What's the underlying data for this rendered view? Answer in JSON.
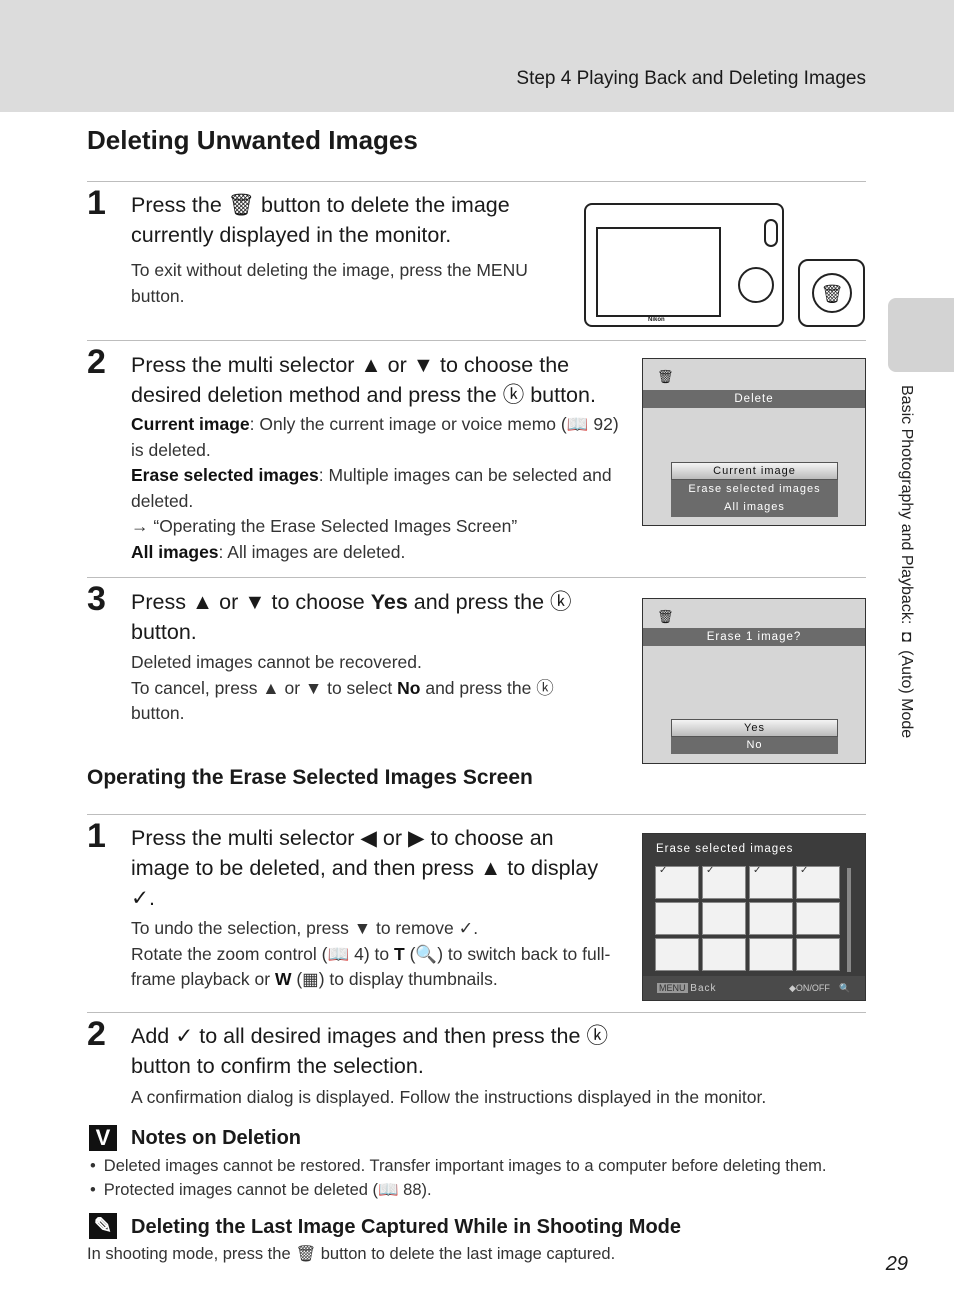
{
  "header": {
    "running_head": "Step 4 Playing Back and Deleting Images",
    "page_number": "29"
  },
  "side_tab": {
    "label": "Basic Photography and Playback: ◘ (Auto) Mode"
  },
  "title": "Deleting Unwanted Images",
  "steps_main": [
    {
      "number": "1",
      "heading": "Press the 🗑 button to delete the image currently displayed in the monitor.",
      "body": [
        "To exit without deleting the image, press the MENU button."
      ]
    },
    {
      "number": "2",
      "heading": "Press the multi selector ▲ or ▼ to choose the desired deletion method and press the ⓚ button.",
      "items": [
        {
          "term": "Current image",
          "desc": ": Only the current image or voice memo (📖 92) is deleted."
        },
        {
          "term": "Erase selected images",
          "desc": ": Multiple images can be selected and deleted."
        },
        {
          "term": "",
          "desc": "→ “Operating the Erase Selected Images Screen”"
        },
        {
          "term": "All images",
          "desc": ": All images are deleted."
        }
      ]
    },
    {
      "number": "3",
      "heading_pre": "Press ▲ or ▼ to choose ",
      "heading_bold": "Yes",
      "heading_post": " and press the ⓚ button.",
      "body1": "Deleted images cannot be recovered.",
      "body2_pre": "To cancel, press ▲ or ▼ to select ",
      "body2_bold": "No",
      "body2_post": " and press the ⓚ button."
    }
  ],
  "subsection": {
    "title": "Operating the Erase Selected Images Screen",
    "steps": [
      {
        "number": "1",
        "heading": "Press the multi selector ◀ or ▶ to choose an image to be deleted, and then press ▲ to display ✓.",
        "body1": "To undo the selection, press ▼ to remove ✓.",
        "body2_pre": "Rotate the zoom control (📖 4) to ",
        "body2_t": "T",
        "body2_mid": " (🔍) to switch back to full-frame playback or ",
        "body2_w": "W",
        "body2_post": " (▦) to display thumbnails."
      },
      {
        "number": "2",
        "heading": "Add ✓ to all desired images and then press the ⓚ button to confirm the selection.",
        "body": "A confirmation dialog is displayed. Follow the instructions displayed in the monitor."
      }
    ]
  },
  "notes": {
    "icon": "V",
    "title": "Notes on Deletion",
    "bullets": [
      "Deleted images cannot be restored. Transfer important images to a computer before deleting them.",
      "Protected images cannot be deleted (📖 88)."
    ]
  },
  "tip": {
    "icon": "✎",
    "title": "Deleting the Last Image Captured While in Shooting Mode",
    "body": "In shooting mode, press the 🗑 button to delete the last image captured."
  },
  "screens": {
    "delete_menu": {
      "trash": "🗑",
      "title": "Delete",
      "options": [
        "Current image",
        "Erase selected images",
        "All images"
      ],
      "selected_index": 0
    },
    "confirm": {
      "trash": "🗑",
      "title": "Erase 1 image?",
      "options": [
        "Yes",
        "No"
      ],
      "selected_index": 0
    },
    "erase_selected": {
      "title": "Erase selected images",
      "thumbnails": [
        "✓",
        "✓",
        "✓",
        "✓",
        "",
        "",
        "",
        "",
        "",
        "",
        "",
        ""
      ],
      "footer_menu": "MENU",
      "footer_back": "Back",
      "footer_onoff": "◆ON/OFF",
      "footer_zoom": "🔍"
    },
    "camera": {
      "brand": "Nikon",
      "trash": "🗑"
    }
  }
}
